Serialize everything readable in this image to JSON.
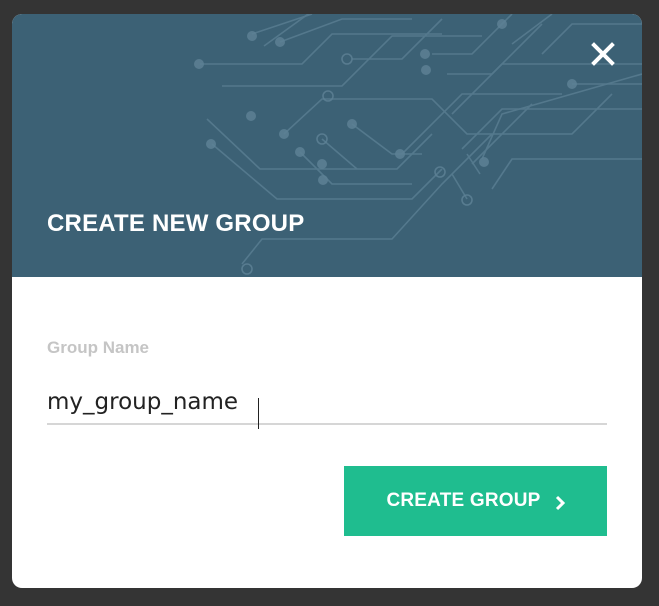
{
  "dialog": {
    "title": "CREATE NEW GROUP",
    "close_icon": "close-icon",
    "header_pattern": "circuit-board-pattern"
  },
  "form": {
    "group_name_label": "Group Name",
    "group_name_value": "my_group_name"
  },
  "actions": {
    "create_label": "CREATE GROUP",
    "create_icon": "chevron-right-icon"
  },
  "colors": {
    "header_bg": "#3c6175",
    "accent_button": "#1fbd8f",
    "backdrop": "#343434",
    "label_gray": "#c5c5c5"
  }
}
